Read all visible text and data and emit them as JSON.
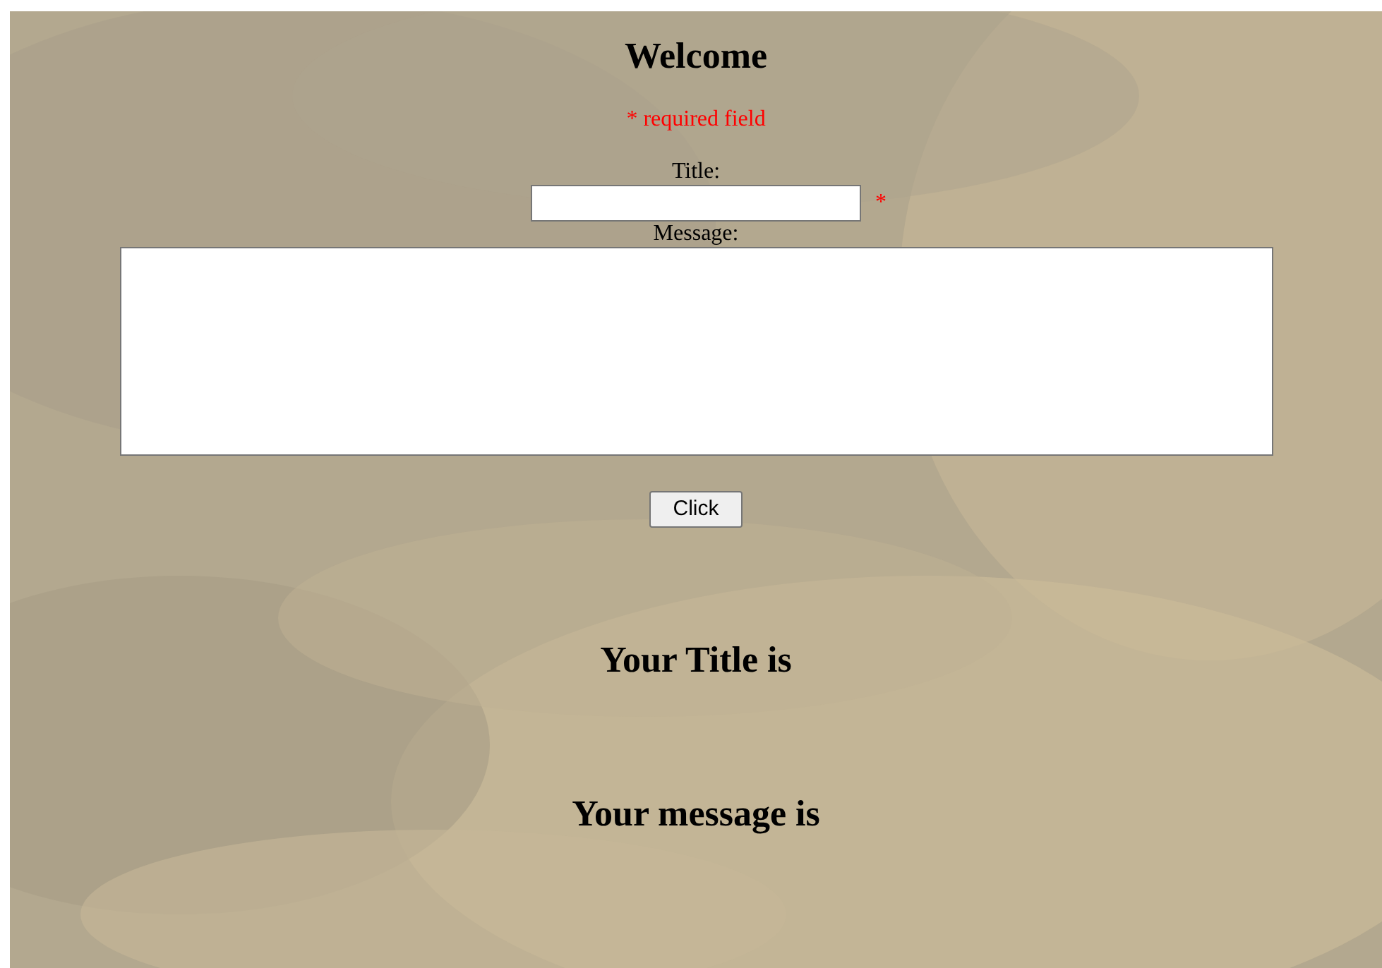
{
  "heading": "Welcome",
  "required_note": "* required field",
  "title_field": {
    "label": "Title:",
    "required_mark": "*"
  },
  "message_field": {
    "label": "Message:"
  },
  "submit_button": "Click",
  "result_headings": [
    "Your Title is",
    "Your message is"
  ]
}
